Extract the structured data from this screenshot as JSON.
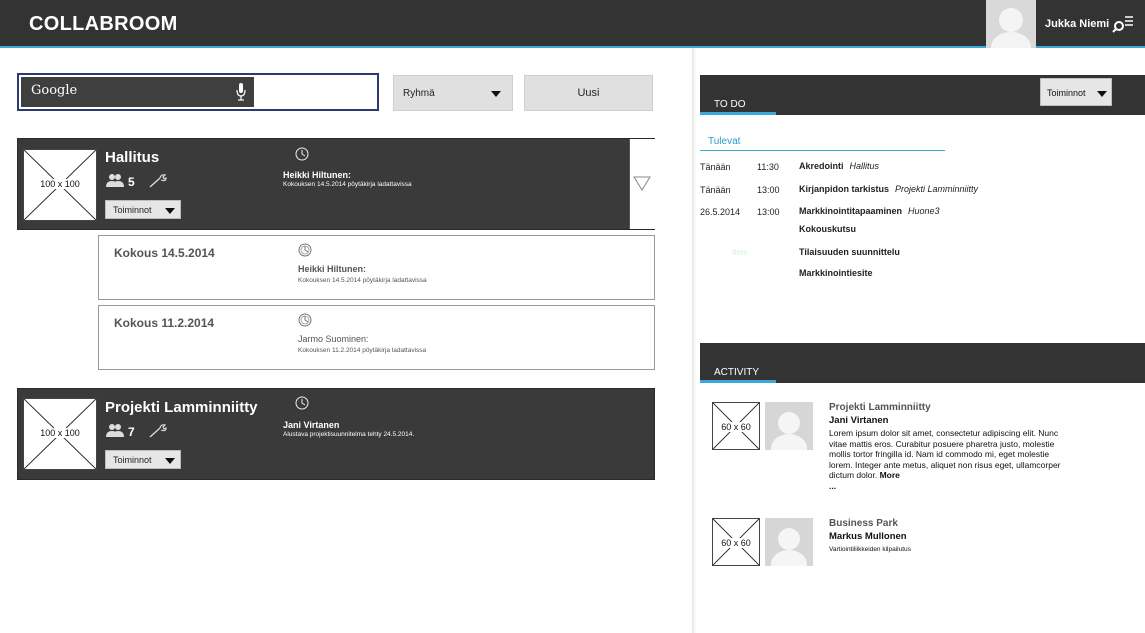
{
  "app": {
    "title": "COLLABROOM"
  },
  "user": {
    "name": "Jukka Niemi"
  },
  "toolbar": {
    "search_label": "Google",
    "group_select": "Ryhmä",
    "new_button": "Uusi"
  },
  "groups": [
    {
      "title": "Hallitus",
      "image_label": "100 x 100",
      "members": "5",
      "actions_label": "Toiminnot",
      "latest_author": "Heikki Hiltunen:",
      "latest_text": "Kokouksen 14.5.2014 pöytäkirja ladattavissa",
      "meetings": [
        {
          "title": "Kokous 14.5.2014",
          "author": "Heikki Hiltunen:",
          "text": "Kokouksen 14.5.2014 pöytäkirja ladattavissa"
        },
        {
          "title": "Kokous 11.2.2014",
          "author": "Jarmo Suominen:",
          "text": "Kokouksen 11.2.2014 pöytäkirja ladattavissa"
        }
      ]
    },
    {
      "title": "Projekti Lamminniitty",
      "image_label": "100 x 100",
      "members": "7",
      "actions_label": "Toiminnot",
      "latest_author": "Jani Virtanen",
      "latest_text": "Alustava projektisuunnitelma tehty 24.5.2014."
    }
  ],
  "todo": {
    "tab": "TO DO",
    "actions_label": "Toiminnot",
    "upcoming_label": "Tulevat",
    "items": [
      {
        "date": "Tänään",
        "time": "11:30",
        "name": "Akredointi",
        "context": "Hallitus"
      },
      {
        "date": "Tänään",
        "time": "13:00",
        "name": "Kirjanpidon tarkistus",
        "context": "Projekti Lamminniitty"
      },
      {
        "date": "26.5.2014",
        "time": "13:00",
        "name": "Markkinointitapaaminen",
        "context": "Huone3"
      },
      {
        "date": "",
        "time": "",
        "name": "Kokouskutsu",
        "context": ""
      },
      {
        "date": "",
        "time": "",
        "name": "Tilaisuuden suunnittelu",
        "context": "",
        "faint": "Item"
      },
      {
        "date": "",
        "time": "",
        "name": "Markkinointiesite",
        "context": ""
      }
    ]
  },
  "activity": {
    "tab": "ACTIVITY",
    "items": [
      {
        "image_label": "60 x 60",
        "project": "Projekti Lamminniitty",
        "person": "Jani Virtanen",
        "text": "Lorem ipsum dolor sit amet, consectetur adipiscing elit. Nunc vitae mattis eros. Curabitur posuere pharetra justo, molestie mollis tortor fringilla id. Nam id commodo mi, eget molestie lorem. Integer ante metus, aliquet non risus eget, ullamcorper dictum dolor.",
        "more": "More",
        "ellipsis": "..."
      },
      {
        "image_label": "60 x 60",
        "project": "Business Park",
        "person": "Markus Mullonen",
        "text": "Vartiointiliikkeiden kilpailutus"
      }
    ]
  }
}
